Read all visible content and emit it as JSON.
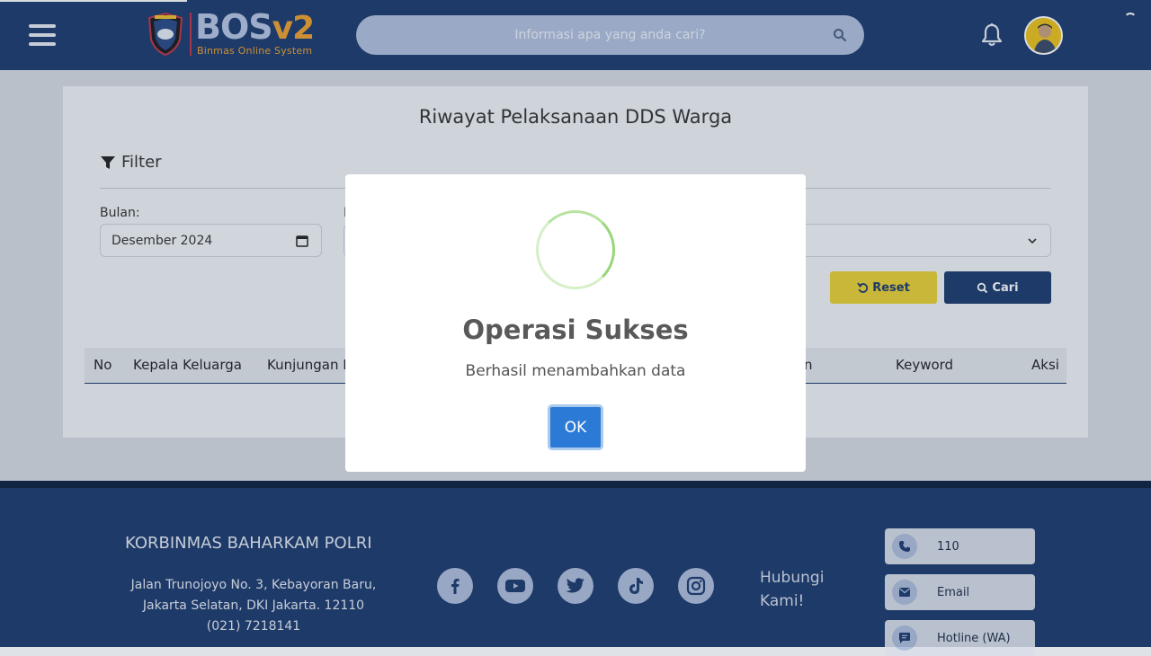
{
  "header": {
    "logo_main": "BOS",
    "logo_version": "v2",
    "logo_subtitle": "Binmas Online System",
    "search_placeholder": "Informasi apa yang anda cari?"
  },
  "page": {
    "title": "Riwayat Pelaksanaan DDS Warga",
    "filter_label": "Filter",
    "bulan_label": "Bulan:",
    "second_label_fragment": "I",
    "bulan_value": "Desember 2024",
    "reset_label": "Reset",
    "cari_label": "Cari"
  },
  "table": {
    "columns": [
      "No",
      "Kepala Keluarga",
      "Kunjungan K",
      "n",
      "Keyword",
      "Aksi"
    ]
  },
  "modal": {
    "title": "Operasi Sukses",
    "message": "Berhasil menambahkan data",
    "ok_label": "OK"
  },
  "footer": {
    "org": "KORBINMAS BAHARKAM POLRI",
    "address": "Jalan Trunojoyo No. 3, Kebayoran Baru, Jakarta Selatan, DKI Jakarta. 12110 (021) 7218141",
    "contact_heading": "Hubungi Kami!",
    "contacts": [
      {
        "label": "110",
        "icon": "phone-icon"
      },
      {
        "label": "Email",
        "icon": "mail-icon"
      },
      {
        "label": "Hotline (WA)",
        "icon": "chat-icon"
      }
    ],
    "socials": [
      "facebook-icon",
      "youtube-icon",
      "twitter-icon",
      "tiktok-icon",
      "instagram-icon"
    ]
  },
  "colors": {
    "header": "#1d3a6c",
    "accent_orange": "#f2a12c",
    "reset_yellow": "#ecd233",
    "ok_blue": "#2b7ad6",
    "success_green": "#99d679"
  }
}
